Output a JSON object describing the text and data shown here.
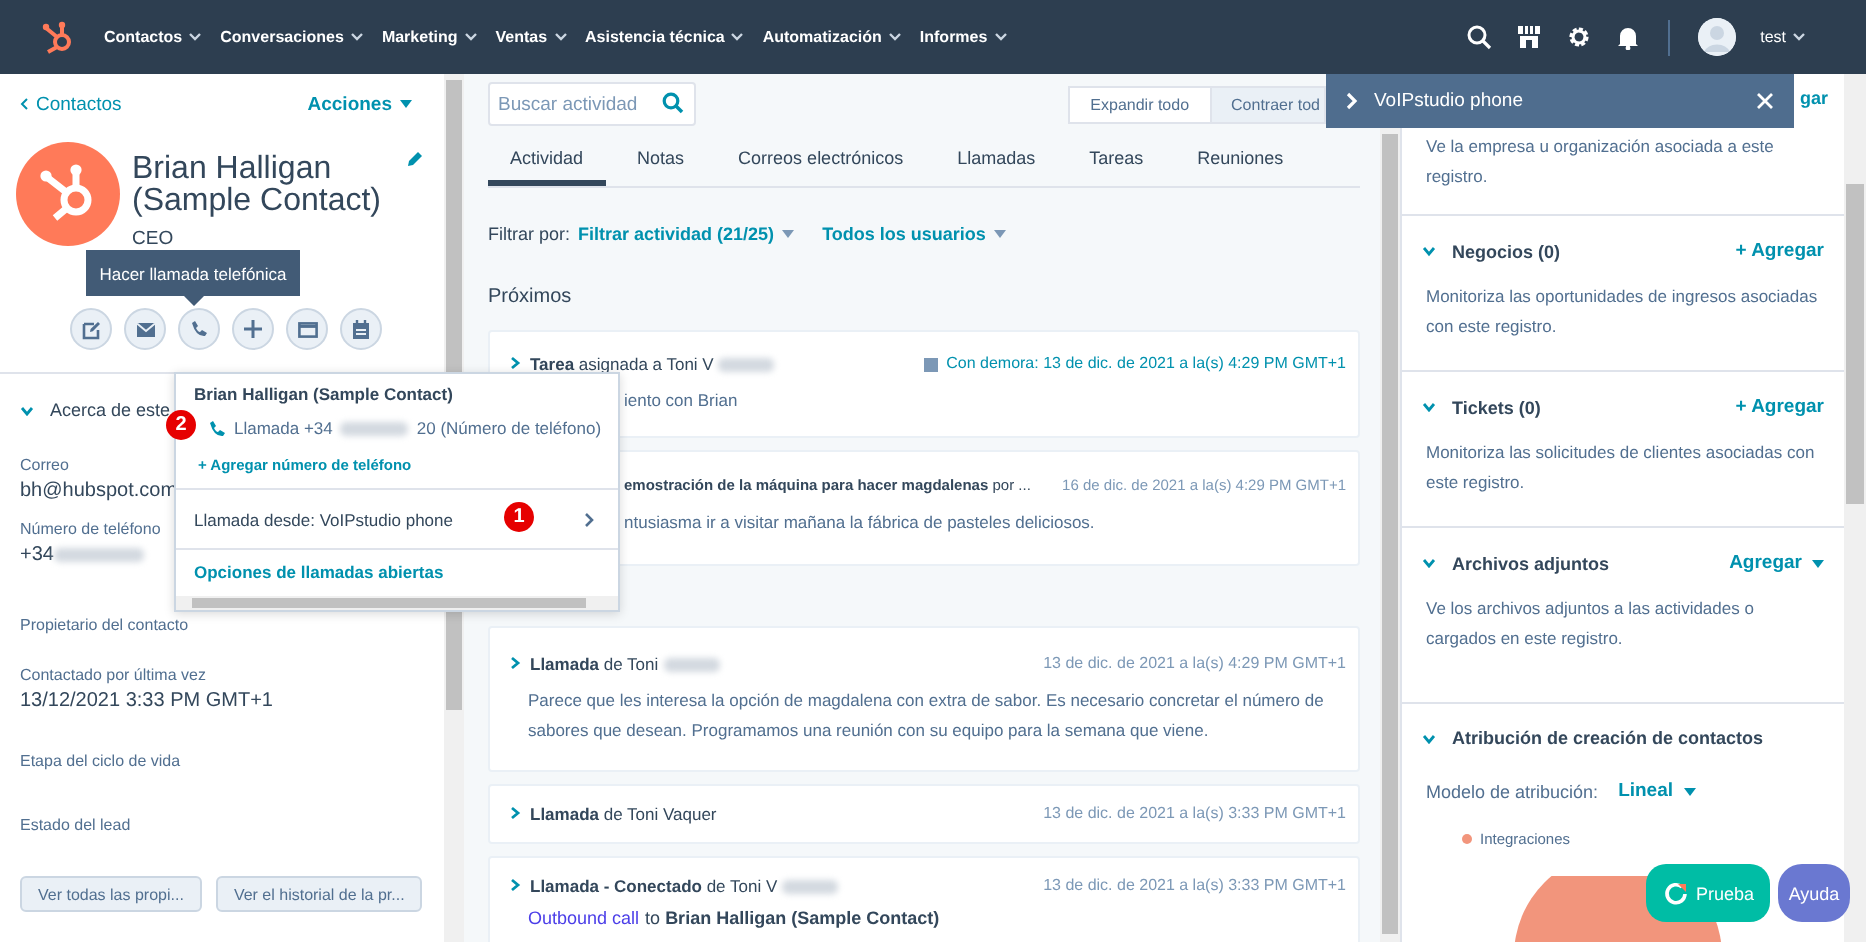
{
  "nav": {
    "menu": [
      {
        "label": "Contactos"
      },
      {
        "label": "Conversaciones"
      },
      {
        "label": "Marketing"
      },
      {
        "label": "Ventas"
      },
      {
        "label": "Asistencia técnica"
      },
      {
        "label": "Automatización"
      },
      {
        "label": "Informes"
      }
    ],
    "user": "test"
  },
  "contact": {
    "back": "Contactos",
    "actions": "Acciones",
    "name": "Brian Halligan (Sample Contact)",
    "title": "CEO",
    "tooltip": "Hacer llamada telefónica"
  },
  "about": {
    "title": "Acerca de este",
    "expanded": true,
    "fields": [
      {
        "label": "Correo",
        "value": "bh@hubspot.com",
        "redacted": false
      },
      {
        "label": "Número de teléfono",
        "value": "+34",
        "redacted": true
      },
      {
        "label": "Propietario del contacto"
      },
      {
        "label": "Contactado por última vez",
        "value": "13/12/2021 3:33 PM GMT+1",
        "redacted": false
      },
      {
        "label": "Etapa del ciclo de vida"
      },
      {
        "label": "Estado del lead"
      }
    ],
    "buttons": [
      "Ver todas las propi...",
      "Ver el historial de la pr..."
    ]
  },
  "activity": {
    "search_placeholder": "Buscar actividad",
    "expand": "Expandir todo",
    "collapse": "Contraer tod",
    "tabs": [
      {
        "label": "Actividad",
        "selected": true
      },
      {
        "label": "Notas",
        "selected": false
      },
      {
        "label": "Correos electrónicos",
        "selected": false
      },
      {
        "label": "Llamadas",
        "selected": false
      },
      {
        "label": "Tareas",
        "selected": false
      },
      {
        "label": "Reuniones",
        "selected": false
      }
    ],
    "filter_label": "Filtrar por:",
    "filter": "Filtrar actividad (21/25)",
    "users": "Todos los usuarios",
    "upcoming": "Próximos",
    "cards": [
      {
        "title": "**Tarea** asignada a Toni V",
        "redacted": true,
        "date": "Con demora: 13 de dic. de 2021 a la(s) 4:29 PM GMT+1",
        "overdue": true,
        "expanded": false,
        "body": "iento con Brian"
      },
      {
        "title": "**emostración de la máquina para hacer magdalenas** por ...",
        "redacted": false,
        "date": "16 de dic. de 2021 a la(s) 4:29 PM GMT+1",
        "overdue": false,
        "body": "ntusiasma ir a visitar mañana la fábrica de pasteles deliciosos."
      },
      {
        "title": "**Llamada** de Toni",
        "redacted": true,
        "date": "13 de dic. de 2021 a la(s) 4:29 PM GMT+1",
        "overdue": false,
        "expanded": false,
        "body": "Parece que les interesa la opción de magdalena con extra de sabor. Es necesario concretar el número de sabores que desean. Programamos una reunión con su equipo para la semana que viene."
      },
      {
        "title": "**Llamada** de Toni Vaquer",
        "redacted": false,
        "date": "13 de dic. de 2021 a la(s) 3:33 PM GMT+1",
        "overdue": false,
        "expanded": false
      },
      {
        "title": "**Llamada - Conectado** de Toni V",
        "redacted": true,
        "date": "13 de dic. de 2021 a la(s) 3:33 PM GMT+1",
        "overdue": false,
        "expanded": false,
        "link": "Outbound call",
        "body": "to **Brian Halligan (Sample Contact)**"
      }
    ]
  },
  "sidebar": {
    "top_action": "gar",
    "top_text": "Ve la empresa u organización asociada a este registro.",
    "sections": [
      {
        "kind": "add",
        "title": "Negocios (0)",
        "action": "+ Agregar",
        "expanded": true,
        "text": "Monitoriza las oportunidades de ingresos asociadas con este registro."
      },
      {
        "kind": "add",
        "title": "Tickets (0)",
        "action": "+ Agregar",
        "expanded": true,
        "text": "Monitoriza las solicitudes de clientes asociadas con este registro."
      },
      {
        "kind": "menu",
        "title": "Archivos adjuntos",
        "action": "Agregar",
        "expanded": true,
        "text": "Ve los archivos adjuntos a las actividades o cargados en este registro."
      },
      {
        "kind": "attribution",
        "title": "Atribución de creación de contactos",
        "expanded": true,
        "model_label": "Modelo de atribución:",
        "model": "Lineal",
        "legend": [
          {
            "label": "Integraciones",
            "color": "#f2957c"
          }
        ]
      }
    ]
  },
  "call_popover": {
    "contact": "Brian Halligan (Sample Contact)",
    "call_prefix": "Llamada +34",
    "call_suffix": "20 (Número de teléfono)",
    "add_phone": "+ Agregar número de teléfono",
    "call_from": "Llamada desde: VoIPstudio phone",
    "open_options": "Opciones de llamadas abiertas"
  },
  "dialer": {
    "title": "VoIPstudio phone"
  },
  "markers": [
    {
      "number": "2"
    },
    {
      "number": "1"
    }
  ],
  "floating": {
    "trial": "Prueba",
    "help": "Ayuda"
  }
}
